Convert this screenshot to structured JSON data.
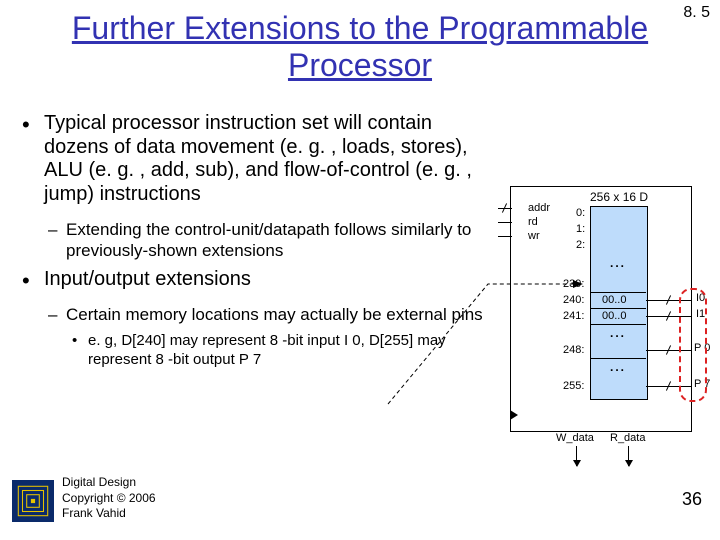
{
  "section": "8. 5",
  "title": "Further Extensions to the Programmable Processor",
  "bullets": {
    "b1": "Typical processor instruction set will contain dozens of data movement (e. g. , loads, stores), ALU (e. g. , add, sub), and flow-of-control (e. g. , jump) instructions",
    "b1a": "Extending the control-unit/datapath follows similarly to previously-shown extensions",
    "b2": "Input/output extensions",
    "b2a": "Certain memory locations may actually be external pins",
    "b2a1": "e. g, D[240] may represent 8 -bit input I 0, D[255] may represent 8 -bit output P 7"
  },
  "diagram": {
    "mem_name": "256 x 16 D",
    "sig_addr": "addr",
    "sig_rd": "rd",
    "sig_wr": "wr",
    "rows": {
      "r0": "0:",
      "r1": "1:",
      "r2": "2:",
      "r239": "239:",
      "r240": "240:",
      "v240": "00..0",
      "r241": "241:",
      "v241": "00..0",
      "r248": "248:",
      "r255": "255:"
    },
    "io": {
      "i0": "I0",
      "i1": "I1",
      "p0": "P 0",
      "p7": "P 7"
    },
    "bot": {
      "w": "W_data",
      "r": "R_data"
    }
  },
  "footer": {
    "line1": "Digital Design",
    "line2": "Copyright © 2006",
    "line3": "Frank Vahid"
  },
  "page": "36"
}
